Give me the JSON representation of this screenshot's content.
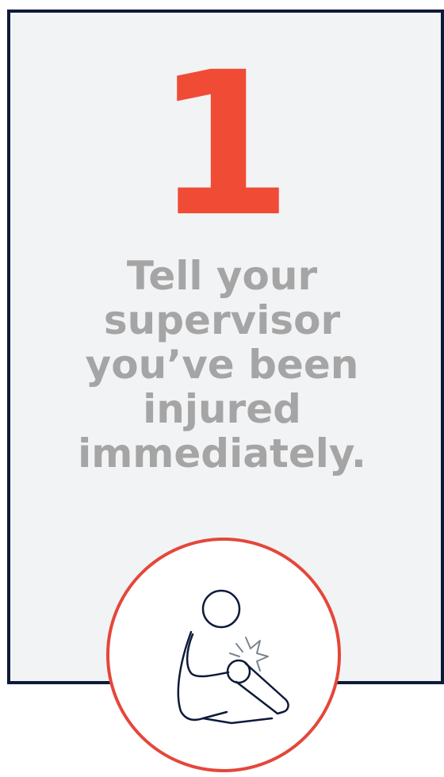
{
  "step": {
    "number": "1",
    "text": "Tell your\nsupervisor\nyou’ve been\ninjured\nimmediately."
  },
  "icon": {
    "name": "injured-person-icon"
  },
  "colors": {
    "number": "#f04b35",
    "text": "#a5a5a5",
    "card_background": "#f2f3f5",
    "card_border": "#0e1a3a",
    "circle_border": "#e4473a",
    "icon_stroke": "#0e1a3a",
    "impact_stroke": "#7b8391"
  }
}
